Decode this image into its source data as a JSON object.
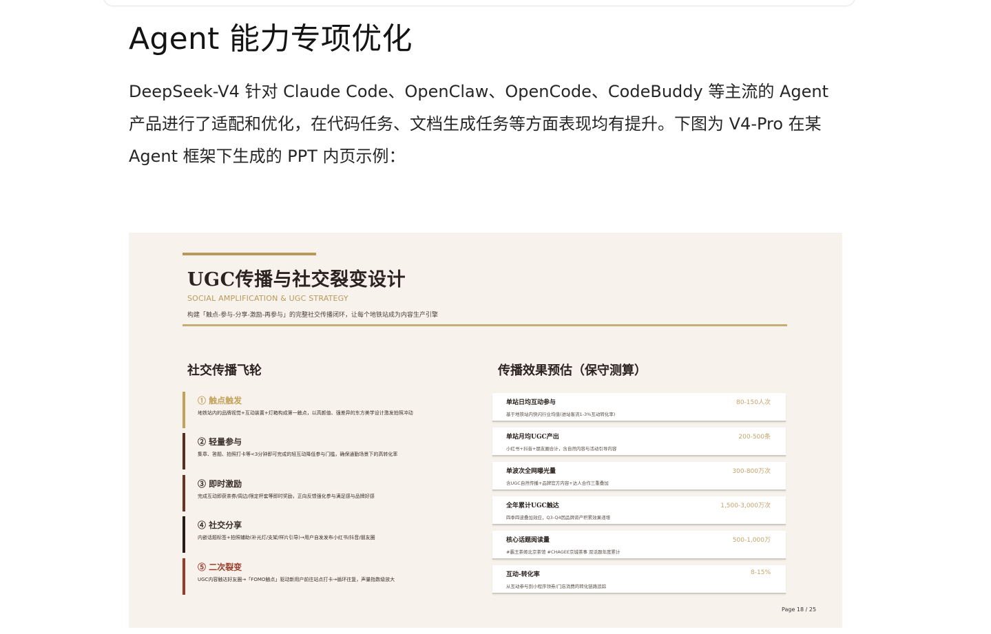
{
  "article": {
    "title": "Agent 能力专项优化",
    "paragraph": "DeepSeek-V4 针对 Claude Code、OpenClaw、OpenCode、CodeBuddy 等主流的 Agent 产品进行了适配和优化，在代码任务、文档生成任务等方面表现均有提升。下图为 V4-Pro 在某 Agent 框架下生成的 PPT 内页示例："
  },
  "slide": {
    "title": "UGC传播与社交裂变设计",
    "subtitle_en": "SOCIAL AMPLIFICATION & UGC STRATEGY",
    "description": "构建「触点-参与-分享-激励-再参与」的完整社交传播闭环，让每个地铁站成为内容生产引擎",
    "left_heading": "社交传播飞轮",
    "right_heading": "传播效果预估（保守测算）",
    "page": "Page 18 / 25",
    "colors": {
      "gold": "#b8995a",
      "brown": "#5a2e1e",
      "dark": "#2a1a14",
      "red": "#9a3a28",
      "background": "#f7f3ec"
    },
    "flywheel": [
      {
        "title": "① 触点触发",
        "desc": "地铁站内的品牌视觉+互动装置+灯箱构成第一触点，以高颜值、强差异的东方美学设计激发拍照冲动",
        "color": "#c4a15a",
        "title_color": "#c4a15a"
      },
      {
        "title": "② 轻量参与",
        "desc": "集章、答题、拍照打卡等<3分钟即可完成的轻互动降低参与门槛，确保通勤场景下的高转化率",
        "color": "#5a2e1e",
        "title_color": "#3a2e28"
      },
      {
        "title": "③ 即时激励",
        "desc": "完成互动即获茶券/周边/限定杯套等即时奖励，正向反馈强化参与满足感与品牌好感",
        "color": "#6b3322",
        "title_color": "#3a2e28"
      },
      {
        "title": "④ 社交分享",
        "desc": "内嵌话题标签+拍照辅助(补光灯/支架/样片引导)→用户自发发布小红书/抖音/朋友圈",
        "color": "#2a1a14",
        "title_color": "#3a2e28"
      },
      {
        "title": "⑤ 二次裂变",
        "desc": "UGC内容触达好友圈→「FOMO触点」驱动新用户前往站点打卡→循环往复，声量指数级放大",
        "color": "#9a3a28",
        "title_color": "#9a3a28"
      }
    ],
    "metrics": [
      {
        "label": "单站日均互动参与",
        "value": "80-150人次",
        "desc": "基于地铁站内快闪行业均值(进站客流1-3%互动转化率)"
      },
      {
        "label": "单站月均UGC产出",
        "value": "200-500条",
        "desc": "小红书+抖音+朋友圈合计，含自然内容与活动引导内容"
      },
      {
        "label": "单波次全网曝光量",
        "value": "300-800万次",
        "desc": "含UGC自然传播+品牌官方内容+达人合作三重叠加"
      },
      {
        "label": "全年累计UGC触达",
        "value": "1,500-3,000万次",
        "desc": "四季四波叠加效应，Q3-Q4因品牌资产积累效果递增"
      },
      {
        "label": "核心话题阅读量",
        "value": "500-1,000万",
        "desc": "#霸王茶姬北京茶馆 #CHAGEE京城茶事 双话题年度累计"
      },
      {
        "label": "互动-转化率",
        "value": "8-15%",
        "desc": "从互动参与到小程序领券/门店消费的转化链路追踪"
      }
    ]
  }
}
